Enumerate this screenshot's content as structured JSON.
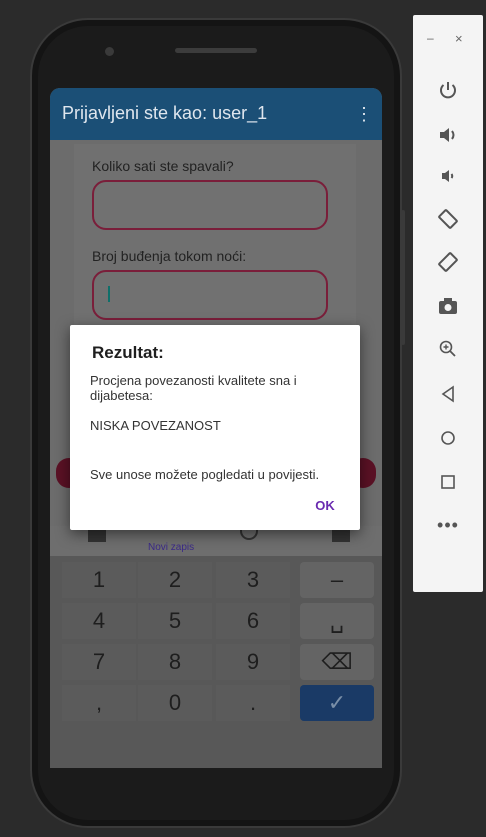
{
  "app": {
    "title": "Prijavljeni ste kao: user_1",
    "menu_icon": "overflow-menu-icon"
  },
  "form": {
    "field1_label": "Koliko sati ste spavali?",
    "field1_value": "",
    "field2_label": "Broj buđenja tokom noći:",
    "field2_value": ""
  },
  "bottom_nav": {
    "active_label": "Novi zapis"
  },
  "dialog": {
    "title": "Rezultat:",
    "message_line1": "Procjena povezanosti kvalitete sna i dijabetesa:",
    "result": "NISKA POVEZANOST",
    "note": "Sve unose možete pogledati u povijesti.",
    "ok_label": "OK"
  },
  "keypad": {
    "rows": [
      [
        "1",
        "2",
        "3",
        "–"
      ],
      [
        "4",
        "5",
        "6",
        "␣"
      ],
      [
        "7",
        "8",
        "9",
        "⌫"
      ],
      [
        ",",
        "0",
        ".",
        "✓"
      ]
    ]
  },
  "toolbar": {
    "minimize": "–",
    "close": "×",
    "icons": [
      "power-icon",
      "volume-up-icon",
      "volume-down-icon",
      "rotate-left-icon",
      "rotate-right-icon",
      "camera-icon",
      "zoom-icon",
      "back-icon",
      "home-icon",
      "overview-icon",
      "more-icon"
    ]
  },
  "colors": {
    "appbar": "#1b4f76",
    "field_border": "#7a1e3a",
    "ok_text": "#6a2bb0",
    "keypad_done": "#1a3a66"
  }
}
